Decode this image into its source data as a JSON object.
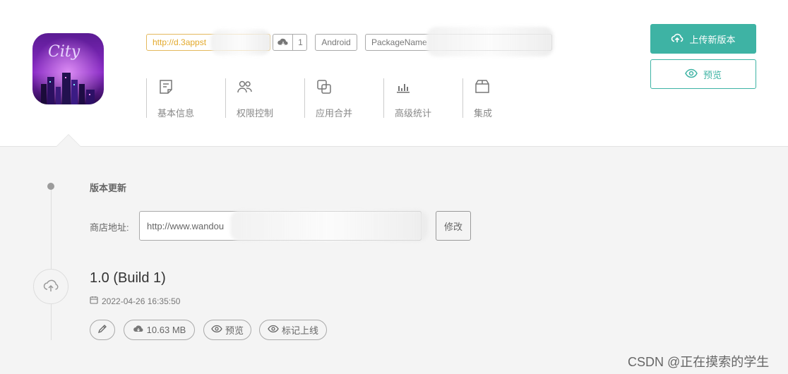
{
  "app": {
    "icon_text": "City",
    "download_link": "http://d.3appst",
    "download_count": "1",
    "platform": "Android",
    "package_label": "PackageName"
  },
  "nav": {
    "items": [
      {
        "label": "基本信息",
        "icon": "document-icon"
      },
      {
        "label": "权限控制",
        "icon": "users-icon"
      },
      {
        "label": "应用合并",
        "icon": "merge-icon"
      },
      {
        "label": "高级统计",
        "icon": "bar-chart-icon"
      },
      {
        "label": "集成",
        "icon": "box-icon"
      }
    ]
  },
  "actions": {
    "upload_label": "上传新版本",
    "preview_label": "预览"
  },
  "update": {
    "title": "版本更新",
    "store_label": "商店地址:",
    "store_value": "http://www.wandou",
    "modify_label": "修改"
  },
  "release": {
    "version": "1.0 (Build 1)",
    "timestamp": "2022-04-26 16:35:50",
    "size": "10.63 MB",
    "preview_label": "预览",
    "mark_label": "标记上线"
  },
  "watermark": "CSDN @正在摸索的学生",
  "colors": {
    "accent": "#3eb3a4",
    "link": "#e3a92b",
    "background": "#f4f4f4"
  }
}
